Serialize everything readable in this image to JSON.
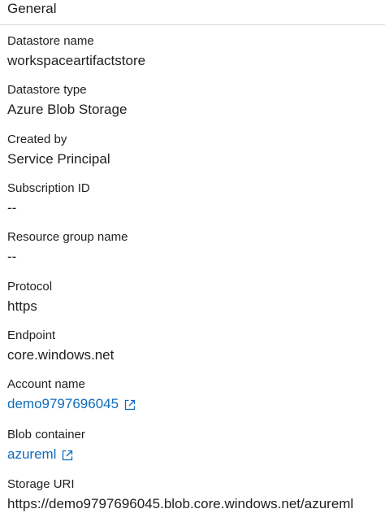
{
  "section": {
    "title": "General"
  },
  "fields": {
    "datastore_name": {
      "label": "Datastore name",
      "value": "workspaceartifactstore"
    },
    "datastore_type": {
      "label": "Datastore type",
      "value": "Azure Blob Storage"
    },
    "created_by": {
      "label": "Created by",
      "value": "Service Principal"
    },
    "subscription_id": {
      "label": "Subscription ID",
      "value": "--"
    },
    "resource_group": {
      "label": "Resource group name",
      "value": "--"
    },
    "protocol": {
      "label": "Protocol",
      "value": "https"
    },
    "endpoint": {
      "label": "Endpoint",
      "value": "core.windows.net"
    },
    "account_name": {
      "label": "Account name",
      "value": "demo9797696045",
      "icon": "external-link-icon"
    },
    "blob_container": {
      "label": "Blob container",
      "value": "azureml",
      "icon": "external-link-icon"
    },
    "storage_uri": {
      "label": "Storage URI",
      "value": "https://demo9797696045.blob.core.windows.net/azureml"
    }
  },
  "colors": {
    "link": "#0f6cbd",
    "text": "#201f1e",
    "divider": "#d9d9d9"
  }
}
